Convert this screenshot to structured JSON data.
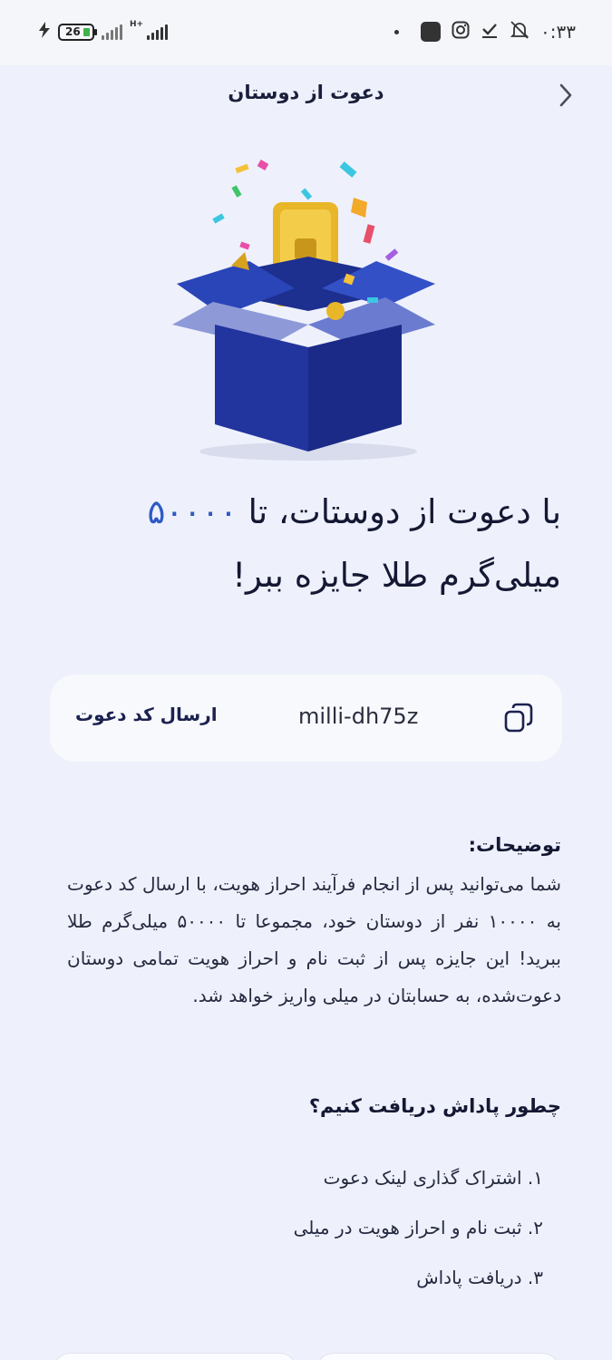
{
  "status_bar": {
    "time": "۰:۳۳",
    "battery": "26",
    "network": "H+",
    "icons": [
      "bell-muted-icon",
      "check-icon",
      "instagram-icon",
      "app-icon",
      "dot-icon",
      "charging-icon"
    ]
  },
  "header": {
    "title": "دعوت از دوستان",
    "back_icon": "chevron-right-icon"
  },
  "headline": {
    "part1": "با دعوت از دوستات، تا ",
    "amount": "۵۰۰۰۰",
    "part2": "میلی‌گرم طلا جایزه ببر!"
  },
  "invite": {
    "code": "milli-dh75z",
    "send_label": "ارسال کد دعوت",
    "copy_icon": "copy-icon"
  },
  "description": {
    "title": "توضیحات:",
    "body": "شما می‌توانید پس از انجام فرآیند احراز هویت، با ارسال کد دعوت به ۱۰۰۰۰ نفر از دوستان خود، مجموعا تا ۵۰۰۰۰ میلی‌گرم طلا ببرید! این جایزه پس از ثبت نام و احراز هویت تمامی دوستان دعوت‌شده، به حسابتان در میلی واریز خواهد شد."
  },
  "how_to": {
    "title": "چطور پاداش دریافت کنیم؟",
    "steps": [
      "۱. اشتراک گذاری لینک دعوت",
      "۲. ثبت نام و احراز هویت در میلی",
      "۳. دریافت پاداش"
    ]
  },
  "colors": {
    "accent": "#2f5ac4",
    "background": "#eef1fb",
    "card": "#f8f9fc",
    "text": "#141833"
  }
}
